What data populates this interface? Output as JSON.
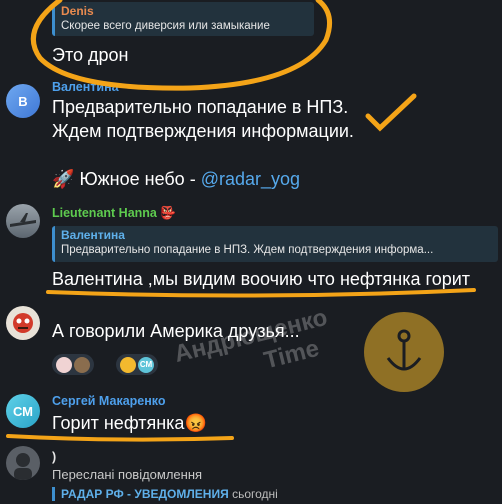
{
  "messages": [
    {
      "id": "m1",
      "quote": {
        "name": "Denis",
        "text": "Скорее всего диверсия или замыкание"
      },
      "text": "Это дрон"
    },
    {
      "id": "m2",
      "avatar_initial": "В",
      "sender": "Валентина",
      "lines": [
        "Предварительно попадание в НПЗ.",
        "Ждем подтверждения информации."
      ],
      "channel_emoji": "🚀",
      "channel_text": "Южное небо - ",
      "channel_link": "@radar_yog"
    },
    {
      "id": "m3",
      "sender": "Lieutenant Hanna",
      "sender_emoji": "👺",
      "quote": {
        "name": "Валентина",
        "text": "Предварительно попадание в НПЗ.  Ждем подтверждения информа..."
      },
      "text": "Валентина ,мы видим воочию что нефтянка горит"
    },
    {
      "id": "m4",
      "text": "А говорили Америка друзья...",
      "reaction_badge": "СМ"
    },
    {
      "id": "m5",
      "avatar_initial": "СМ",
      "sender": "Сергей Макаренко",
      "text": "Горит нефтянка",
      "text_emoji": "😡"
    },
    {
      "id": "m6",
      "sender": ")",
      "forward_label": "Переслані повідомлення",
      "forward_from": "РАДАР РФ - УВЕДОМЛЕНИЯ",
      "forward_time": "сьогодні"
    }
  ],
  "watermark": {
    "line1": "Андрющенко",
    "line2": "Time"
  },
  "colors": {
    "background": "#1a1d22",
    "annotation": "#f4a418",
    "link": "#56a9ec",
    "quote_bar": "#3d8fcf"
  }
}
